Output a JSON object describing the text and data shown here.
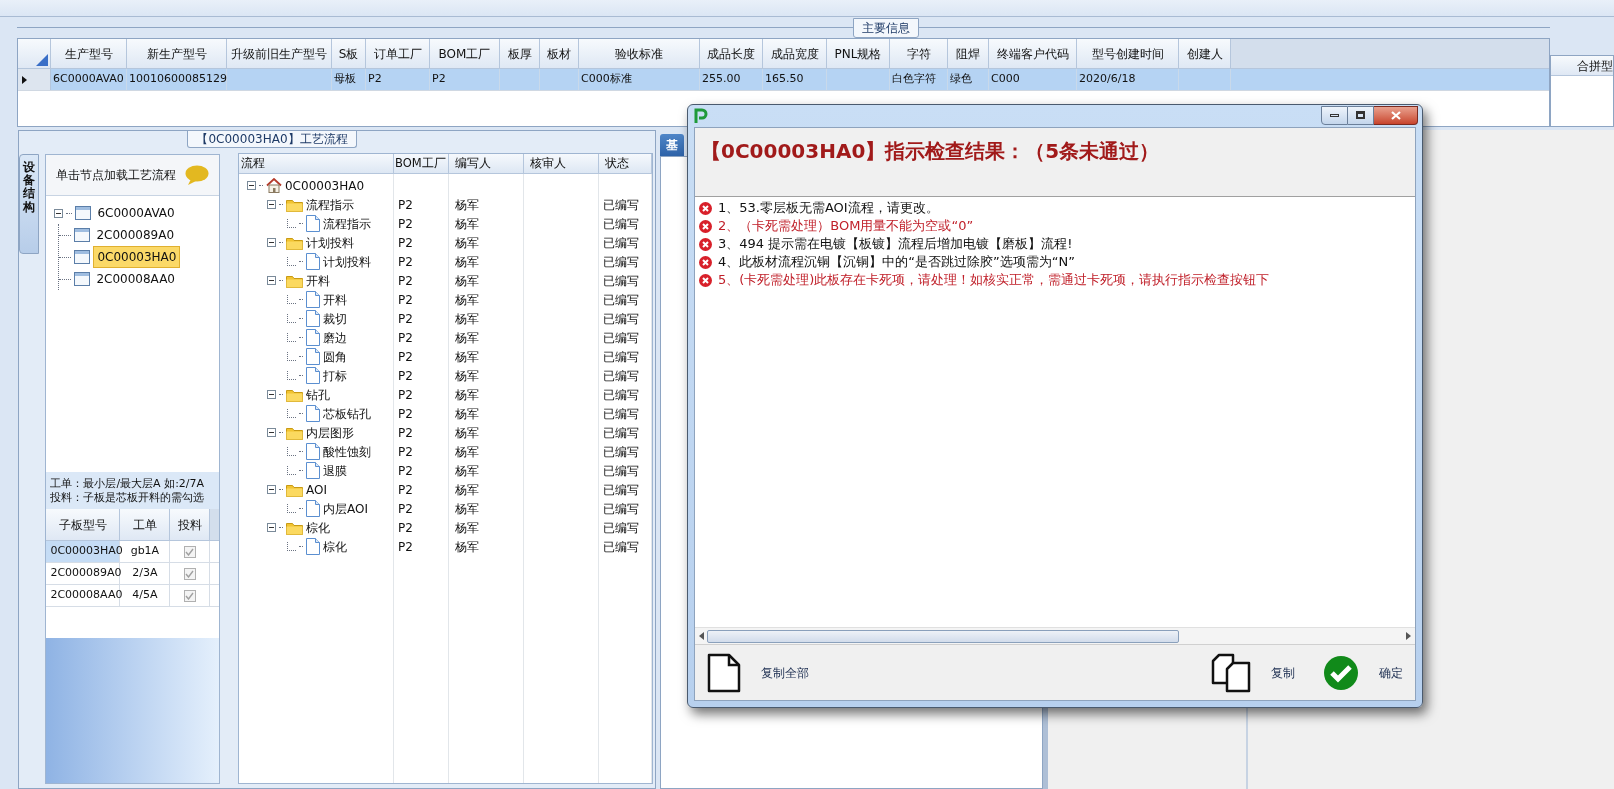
{
  "main_info": {
    "legend": "主要信息",
    "row_selected": true,
    "columns": [
      {
        "label": "生产型号",
        "value": "6C0000AVA0"
      },
      {
        "label": "新生产型号",
        "value": "10010600085129"
      },
      {
        "label": "升级前旧生产型号"
      },
      {
        "label": "S板",
        "value": "母板"
      },
      {
        "label": "订单工厂",
        "value": "P2"
      },
      {
        "label": "BOM工厂",
        "value": "P2"
      },
      {
        "label": "板厚"
      },
      {
        "label": "板材"
      },
      {
        "label": "验收标准",
        "value": "C000标准"
      },
      {
        "label": "成品长度",
        "value": "255.00"
      },
      {
        "label": "成品宽度",
        "value": "165.50"
      },
      {
        "label": "PNL规格"
      },
      {
        "label": "字符",
        "value": "白色字符"
      },
      {
        "label": "阻焊",
        "value": "绿色"
      },
      {
        "label": "终端客户代码",
        "value": "C000"
      },
      {
        "label": "型号创建时间",
        "value": "2020/6/18"
      },
      {
        "label": "创建人"
      }
    ]
  },
  "merge_panel": {
    "header": "合拼型"
  },
  "process_panel": {
    "legend": "【0C00003HA0】工艺流程",
    "side_tab": "设备结构",
    "tree_header": "单击节点加载工艺流程",
    "board_tree": {
      "label": "6C0000AVA0",
      "expanded": true,
      "selected": false,
      "children": [
        {
          "label": "2C000089A0",
          "selected": false
        },
        {
          "label": "0C00003HA0",
          "selected": true
        },
        {
          "label": "2C00008AA0",
          "selected": false
        }
      ]
    },
    "notes": [
      "工单：最小层/最大层A 如:2/7A",
      "投料：子板是芯板开料的需勾选"
    ],
    "sub_table": {
      "columns": [
        "子板型号",
        "工单",
        "投料"
      ],
      "rows": [
        {
          "board": "0C00003HA0",
          "order": "gb1A",
          "feed_checked": true,
          "selected": true
        },
        {
          "board": "2C000089A0",
          "order": "2/3A",
          "feed_checked": true,
          "selected": false
        },
        {
          "board": "2C00008AA0",
          "order": "4/5A",
          "feed_checked": true,
          "selected": false
        }
      ]
    },
    "flow_grid": {
      "columns": [
        "流程",
        "BOM工厂",
        "编写人",
        "核审人",
        "状态"
      ],
      "root": {
        "label": "0C00003HA0",
        "expanded": true,
        "children": [
          {
            "label": "流程指示",
            "bom": "P2",
            "writer": "杨军",
            "status": "已编写",
            "expanded": true,
            "children": [
              {
                "label": "流程指示",
                "bom": "P2",
                "writer": "杨军",
                "status": "已编写"
              }
            ]
          },
          {
            "label": "计划投料",
            "bom": "P2",
            "writer": "杨军",
            "status": "已编写",
            "expanded": true,
            "children": [
              {
                "label": "计划投料",
                "bom": "P2",
                "writer": "杨军",
                "status": "已编写"
              }
            ]
          },
          {
            "label": "开料",
            "bom": "P2",
            "writer": "杨军",
            "status": "已编写",
            "expanded": true,
            "children": [
              {
                "label": "开料",
                "bom": "P2",
                "writer": "杨军",
                "status": "已编写"
              },
              {
                "label": "裁切",
                "bom": "P2",
                "writer": "杨军",
                "status": "已编写"
              },
              {
                "label": "磨边",
                "bom": "P2",
                "writer": "杨军",
                "status": "已编写"
              },
              {
                "label": "圆角",
                "bom": "P2",
                "writer": "杨军",
                "status": "已编写"
              },
              {
                "label": "打标",
                "bom": "P2",
                "writer": "杨军",
                "status": "已编写"
              }
            ]
          },
          {
            "label": "钻孔",
            "bom": "P2",
            "writer": "杨军",
            "status": "已编写",
            "expanded": true,
            "children": [
              {
                "label": "芯板钻孔",
                "bom": "P2",
                "writer": "杨军",
                "status": "已编写"
              }
            ]
          },
          {
            "label": "内层图形",
            "bom": "P2",
            "writer": "杨军",
            "status": "已编写",
            "expanded": true,
            "children": [
              {
                "label": "酸性蚀刻",
                "bom": "P2",
                "writer": "杨军",
                "status": "已编写"
              },
              {
                "label": "退膜",
                "bom": "P2",
                "writer": "杨军",
                "status": "已编写"
              }
            ]
          },
          {
            "label": "AOI",
            "bom": "P2",
            "writer": "杨军",
            "status": "已编写",
            "expanded": true,
            "children": [
              {
                "label": "内层AOI",
                "bom": "P2",
                "writer": "杨军",
                "status": "已编写"
              }
            ]
          },
          {
            "label": "棕化",
            "bom": "P2",
            "writer": "杨军",
            "status": "已编写",
            "expanded": true,
            "children": [
              {
                "label": "棕化",
                "bom": "P2",
                "writer": "杨军",
                "status": "已编写"
              }
            ]
          }
        ]
      }
    }
  },
  "side_panel": {
    "tab": "基"
  },
  "dialog": {
    "heading": "【0C00003HA0】指示检查结果：（5条未通过）",
    "messages": [
      {
        "text": "1、53.零层板无需AOI流程，请更改。",
        "blocking": false
      },
      {
        "text": "2、（卡死需处理）BOM用量不能为空或“0”",
        "blocking": true
      },
      {
        "text": "3、494 提示需在电镀【板镀】流程后增加电镀【磨板】流程!",
        "blocking": false
      },
      {
        "text": "4、此板材流程沉铜【沉铜】中的“是否跳过除胶”选项需为“N”",
        "blocking": false
      },
      {
        "text": "5、(卡死需处理)此板存在卡死项，请处理！如核实正常，需通过卡死项，请执行指示检查按钮下",
        "blocking": true
      }
    ],
    "buttons": [
      {
        "label": "复制全部",
        "kind": "copy_all"
      },
      {
        "label": "复制",
        "kind": "copy"
      },
      {
        "label": "确定",
        "kind": "ok"
      }
    ]
  }
}
